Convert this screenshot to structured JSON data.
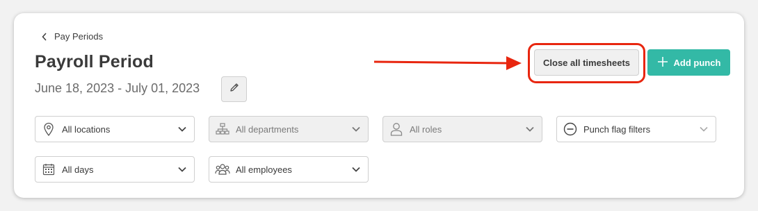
{
  "breadcrumb": {
    "label": "Pay Periods"
  },
  "header": {
    "title": "Payroll Period",
    "date_range": "June 18, 2023 - July 01, 2023"
  },
  "actions": {
    "close_all_label": "Close all timesheets",
    "add_punch_label": "Add punch"
  },
  "filters": {
    "locations": "All locations",
    "departments": "All departments",
    "roles": "All roles",
    "punch_flags": "Punch flag filters",
    "days": "All days",
    "employees": "All employees"
  },
  "colors": {
    "accent": "#33b9a6",
    "annotation": "#e8260f"
  }
}
